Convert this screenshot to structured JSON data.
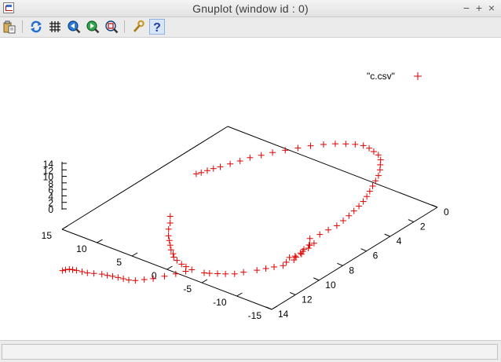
{
  "window": {
    "title": "Gnuplot (window id : 0)",
    "controls": {
      "minimize": "−",
      "maximize": "+",
      "close": "×"
    }
  },
  "toolbar": {
    "buttons": [
      {
        "name": "copy-to-clipboard",
        "icon": "clipboard-icon"
      },
      {
        "name": "replot",
        "icon": "refresh-icon"
      },
      {
        "name": "toggle-grid",
        "icon": "grid-icon"
      },
      {
        "name": "previous-zoom",
        "icon": "zoom-previous-icon"
      },
      {
        "name": "next-zoom",
        "icon": "zoom-next-icon"
      },
      {
        "name": "autoscale",
        "icon": "autoscale-icon"
      },
      {
        "name": "preferences",
        "icon": "wrench-icon"
      },
      {
        "name": "help",
        "icon": "question-mark-icon"
      }
    ]
  },
  "statusbar": {
    "text": ""
  },
  "chart_data": {
    "type": "scatter",
    "dimensions": 3,
    "title": "",
    "legend": {
      "label": "\"c.csv\"",
      "marker": "+",
      "position": "top-right"
    },
    "marker_color": "#e00000",
    "axes": {
      "x": {
        "ticks": [
          "15",
          "10",
          "5",
          "0",
          "-5",
          "-10",
          "-15"
        ],
        "range": [
          -15,
          15
        ]
      },
      "y": {
        "ticks": [
          "0",
          "2",
          "4",
          "6",
          "8",
          "10",
          "12",
          "14"
        ],
        "range": [
          0,
          14
        ]
      },
      "z": {
        "ticks": [
          "14",
          "12",
          "10",
          "8",
          "6",
          "4",
          "2",
          "0"
        ],
        "range": [
          0,
          14
        ]
      }
    },
    "series": [
      {
        "points": [
          [
            -12,
            9,
            7
          ],
          [
            -12.4,
            8.4,
            7.2
          ],
          [
            -12.6,
            7.8,
            7.4
          ],
          [
            -12.8,
            7.2,
            7.5
          ],
          [
            -12.7,
            6.6,
            7.6
          ],
          [
            -12.5,
            6,
            7.6
          ],
          [
            -12.2,
            5.4,
            7.5
          ],
          [
            -11.9,
            4.8,
            7.4
          ],
          [
            -11.5,
            4.2,
            7.2
          ],
          [
            -11,
            3.6,
            7
          ],
          [
            -10.4,
            3,
            6.8
          ],
          [
            -9.8,
            2.4,
            6.6
          ],
          [
            -9.2,
            1.8,
            6.4
          ],
          [
            -8.6,
            1.2,
            6.2
          ],
          [
            -7.8,
            0.6,
            6
          ],
          [
            -7,
            0.1,
            5.8
          ],
          [
            -6.2,
            -0.4,
            5.6
          ],
          [
            -5.2,
            -0.8,
            5.4
          ],
          [
            -4.2,
            -1,
            5.2
          ],
          [
            -3.2,
            -1.2,
            5
          ],
          [
            -2.2,
            -1.3,
            4.8
          ],
          [
            -1.2,
            -1.2,
            4.6
          ],
          [
            -0.2,
            -1,
            4.4
          ],
          [
            0.8,
            -0.7,
            4.3
          ],
          [
            1.8,
            -0.3,
            4.2
          ],
          [
            2.8,
            0.2,
            4.1
          ],
          [
            3.6,
            0.8,
            4.1
          ],
          [
            4.4,
            1.4,
            4.1
          ],
          [
            5.2,
            2,
            4.1
          ],
          [
            5.8,
            2.6,
            4.1
          ],
          [
            6.4,
            3.2,
            4.2
          ],
          [
            6.8,
            3.8,
            4.2
          ],
          [
            7.2,
            4.4,
            4.3
          ],
          [
            7.6,
            5,
            4.4
          ],
          [
            7.9,
            5.4,
            4.5
          ],
          [
            8.1,
            5.8,
            4.6
          ],
          [
            8.3,
            6.2,
            4.7
          ],
          [
            8.5,
            6.5,
            4.8
          ],
          [
            -13,
            9.6,
            7.1
          ],
          [
            -13.3,
            9.9,
            7.1
          ],
          [
            -13.2,
            10.3,
            7
          ],
          [
            -13.5,
            10.6,
            7
          ],
          [
            -13.4,
            11,
            6.9
          ],
          [
            -13.6,
            11.3,
            6.9
          ],
          [
            -13.2,
            11.7,
            6.8
          ],
          [
            -13.4,
            12.1,
            6.8
          ],
          [
            -12.8,
            12.5,
            6.8
          ],
          [
            -12.3,
            12.9,
            6.8
          ],
          [
            -11.7,
            13.3,
            6.7
          ],
          [
            -10.8,
            13.9,
            6.7
          ],
          [
            -10.2,
            14.3,
            6.6
          ],
          [
            -9.4,
            14.6,
            6.6
          ],
          [
            -8.6,
            14.8,
            6.5
          ],
          [
            -7.8,
            15,
            6.4
          ],
          [
            -13.1,
            9.3,
            7.1
          ],
          [
            -12.9,
            9.6,
            7.1
          ],
          [
            -13,
            10.1,
            7
          ],
          [
            -13.2,
            10.5,
            6.9
          ],
          [
            -13.1,
            10.9,
            6.8
          ],
          [
            -12.8,
            11.2,
            6.8
          ],
          [
            -7.2,
            15.1,
            6.3
          ],
          [
            -5.6,
            15.2,
            6.2
          ],
          [
            -4.6,
            15.1,
            6.1
          ],
          [
            -3.8,
            15,
            6
          ],
          [
            -2.8,
            14.8,
            5.9
          ],
          [
            -2,
            14.6,
            5.8
          ],
          [
            -1.4,
            14.3,
            5.7
          ],
          [
            -0.6,
            14,
            5.6
          ],
          [
            0.2,
            13.6,
            5.5
          ],
          [
            1,
            13.2,
            5.4
          ],
          [
            1.8,
            12.8,
            5.3
          ],
          [
            2.8,
            12.2,
            5.2
          ],
          [
            3.6,
            11.6,
            5.1
          ],
          [
            4.6,
            11,
            5
          ],
          [
            -5.4,
            15.6,
            6.4
          ],
          [
            -5,
            16.2,
            6.6
          ],
          [
            -4.4,
            16.8,
            6.7
          ],
          [
            -3.8,
            17.4,
            6.8
          ],
          [
            -3.2,
            17.8,
            6.9
          ],
          [
            -2.6,
            18.2,
            7
          ],
          [
            -2,
            18.4,
            7.1
          ],
          [
            -1.4,
            18.5,
            7.2
          ],
          [
            -0.8,
            18.6,
            7.3
          ],
          [
            -0.2,
            18.7,
            7.4
          ],
          [
            0.4,
            18.8,
            7.4
          ],
          [
            1,
            18.9,
            7.5
          ],
          [
            1.8,
            19.1,
            7.5
          ],
          [
            2.4,
            19.3,
            7.6
          ],
          [
            3,
            19.4,
            7.7
          ],
          [
            3.6,
            19.5,
            7.8
          ],
          [
            4,
            19.6,
            7.9
          ],
          [
            4.3,
            19.7,
            8
          ],
          [
            4.5,
            19.9,
            8.1
          ],
          [
            4.6,
            20.1,
            8.2
          ]
        ]
      }
    ]
  }
}
